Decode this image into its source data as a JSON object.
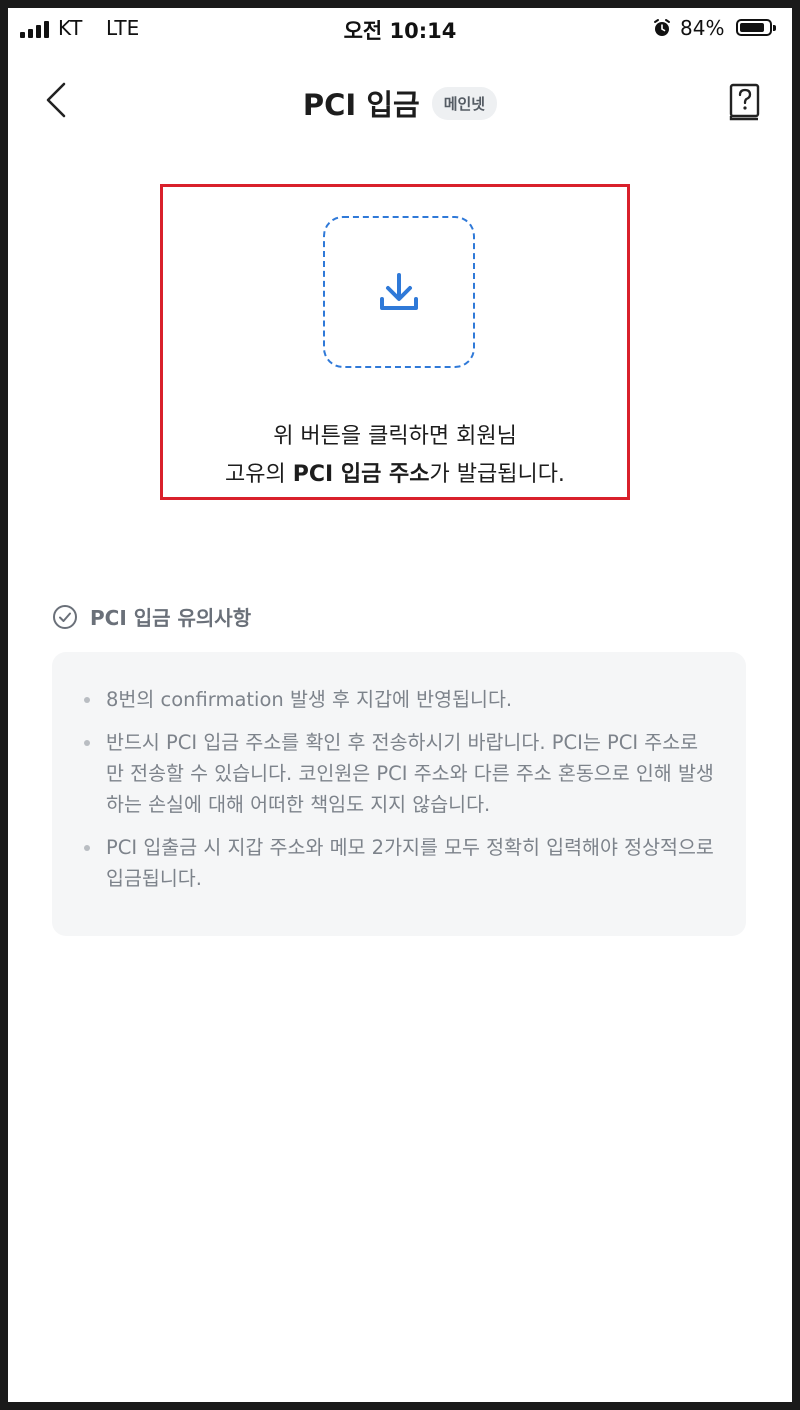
{
  "status_bar": {
    "carrier": "KT",
    "network": "LTE",
    "time": "오전 10:14",
    "battery": "84%",
    "battery_level": 0.84
  },
  "header": {
    "title": "PCI 입금",
    "badge": "메인넷",
    "back_icon": "chevron-left-icon",
    "help_icon": "help-book-icon"
  },
  "deposit": {
    "button_icon": "download-icon",
    "line1": "위 버튼을 클릭하면 회원님",
    "line2_pre": "고유의 ",
    "line2_bold": "PCI 입금 주소",
    "line2_post": "가 발급됩니다."
  },
  "notice": {
    "title": "PCI 입금 유의사항",
    "items": [
      "8번의 confirmation 발생 후 지갑에 반영됩니다.",
      "반드시 PCI 입금 주소를 확인 후 전송하시기 바랍니다. PCI는 PCI 주소로만 전송할 수 있습니다. 코인원은 PCI 주소와 다른 주소 혼동으로 인해 발생하는 손실에 대해 어떠한 책임도 지지 않습니다.",
      "PCI 입출금 시 지갑 주소와 메모 2가지를 모두 정확히 입력해야 정상적으로 입금됩니다."
    ]
  },
  "colors": {
    "accent": "#2f79d8",
    "highlight_border": "#d9202b",
    "notice_bg": "#f5f6f7"
  }
}
